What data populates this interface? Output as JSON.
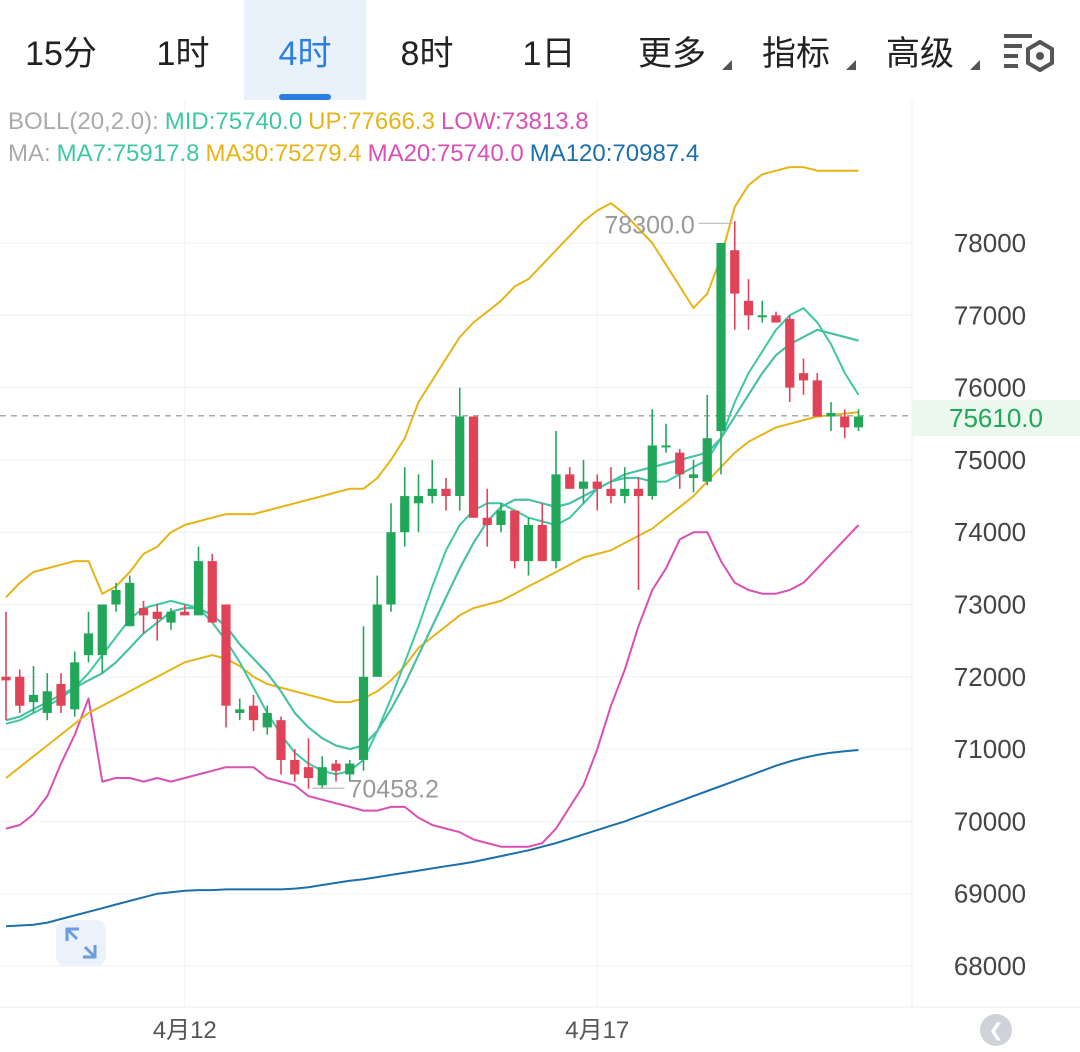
{
  "tabs": [
    {
      "label": "15分",
      "active": false,
      "dropdown": false
    },
    {
      "label": "1时",
      "active": false,
      "dropdown": false
    },
    {
      "label": "4时",
      "active": true,
      "dropdown": false
    },
    {
      "label": "8时",
      "active": false,
      "dropdown": false
    },
    {
      "label": "1日",
      "active": false,
      "dropdown": false
    },
    {
      "label": "更多",
      "active": false,
      "dropdown": true
    },
    {
      "label": "指标",
      "active": false,
      "dropdown": true
    },
    {
      "label": "高级",
      "active": false,
      "dropdown": true
    }
  ],
  "settings_icon": "chart-settings-icon",
  "legend": {
    "boll_name": "BOLL(20,2.0):",
    "boll_mid": "MID:75740.0",
    "boll_up": "UP:77666.3",
    "boll_low": "LOW:73813.8",
    "ma_name": "MA:",
    "ma7": "MA7:75917.8",
    "ma30": "MA30:75279.4",
    "ma20": "MA20:75740.0",
    "ma120": "MA120:70987.4"
  },
  "colors": {
    "up": "#22a65a",
    "down": "#e04358",
    "boll_mid": "#3ec7a3",
    "boll_up": "#e6b417",
    "boll_low": "#d94fb5",
    "ma7": "#3ec7a3",
    "ma30": "#e6b417",
    "ma20": "#d94fb5",
    "ma120": "#1b6fab",
    "price_line": "#aaaaaa"
  },
  "current_price": "75610.0",
  "high_label": "78300.0",
  "low_label": "70458.2",
  "chart_data": {
    "type": "candlestick",
    "y_ticks": [
      "78000",
      "77000",
      "76000",
      "75000",
      "74000",
      "73000",
      "72000",
      "71000",
      "70000",
      "69000",
      "68000"
    ],
    "ylim": [
      67600,
      79600
    ],
    "x_labels": [
      {
        "label": "4月12",
        "index": 13
      },
      {
        "label": "4月17",
        "index": 43
      }
    ],
    "current_price": 75610,
    "candles": [
      [
        72000,
        71950,
        72900,
        71400
      ],
      [
        72000,
        71600,
        72100,
        71500
      ],
      [
        71650,
        71750,
        72150,
        71500
      ],
      [
        71500,
        71800,
        72050,
        71400
      ],
      [
        71900,
        71600,
        72050,
        71500
      ],
      [
        71550,
        72200,
        72350,
        71450
      ],
      [
        72300,
        72600,
        72900,
        72200
      ],
      [
        72300,
        73000,
        73000,
        72050
      ],
      [
        73000,
        73200,
        73300,
        72900
      ],
      [
        72700,
        73300,
        73400,
        72700
      ],
      [
        72950,
        72850,
        73050,
        72600
      ],
      [
        72900,
        72800,
        73000,
        72500
      ],
      [
        72750,
        72900,
        72950,
        72650
      ],
      [
        72900,
        72850,
        73000,
        72850
      ],
      [
        72850,
        73600,
        73800,
        72900
      ],
      [
        73600,
        72750,
        73700,
        72750
      ],
      [
        73000,
        71600,
        73000,
        71300
      ],
      [
        71500,
        71550,
        71700,
        71400
      ],
      [
        71600,
        71400,
        71750,
        71250
      ],
      [
        71300,
        71500,
        71600,
        71200
      ],
      [
        71400,
        70850,
        71450,
        70650
      ],
      [
        70850,
        70650,
        71000,
        70550
      ],
      [
        70750,
        70600,
        71150,
        70450
      ],
      [
        70500,
        70750,
        70900,
        70450
      ],
      [
        70800,
        70700,
        70850,
        70550
      ],
      [
        70650,
        70800,
        70850,
        70550
      ],
      [
        70850,
        72000,
        72700,
        70700
      ],
      [
        72000,
        73000,
        73400,
        72000
      ],
      [
        73000,
        74000,
        74400,
        72900
      ],
      [
        74000,
        74500,
        74900,
        73800
      ],
      [
        74400,
        74500,
        74800,
        74000
      ],
      [
        74500,
        74600,
        75000,
        74400
      ],
      [
        74600,
        74500,
        74750,
        74300
      ],
      [
        74500,
        75600,
        76000,
        74300
      ],
      [
        75600,
        74200,
        75600,
        74200
      ],
      [
        74200,
        74100,
        74600,
        73800
      ],
      [
        74100,
        74300,
        74400,
        74000
      ],
      [
        74300,
        73600,
        74300,
        73500
      ],
      [
        73600,
        74100,
        74200,
        73400
      ],
      [
        74100,
        73600,
        74400,
        73600
      ],
      [
        73600,
        74800,
        75400,
        73500
      ],
      [
        74800,
        74600,
        74900,
        74600
      ],
      [
        74600,
        74700,
        75000,
        74400
      ],
      [
        74700,
        74600,
        74800,
        74300
      ],
      [
        74600,
        74500,
        74900,
        74400
      ],
      [
        74500,
        74600,
        74900,
        74400
      ],
      [
        74600,
        74500,
        74750,
        73200
      ],
      [
        74500,
        75200,
        75700,
        74450
      ],
      [
        75200,
        75200,
        75500,
        75100
      ],
      [
        75100,
        74800,
        75150,
        74600
      ],
      [
        74750,
        74800,
        75000,
        74550
      ],
      [
        74700,
        75300,
        75900,
        74650
      ],
      [
        75400,
        78000,
        78000,
        74800
      ],
      [
        77900,
        77300,
        78300,
        76800
      ],
      [
        77200,
        77000,
        77500,
        76800
      ],
      [
        77000,
        77000,
        77200,
        76900
      ],
      [
        77000,
        76900,
        77050,
        76900
      ],
      [
        76950,
        76000,
        77000,
        75800
      ],
      [
        76200,
        76100,
        76400,
        75900
      ],
      [
        76100,
        75600,
        76200,
        75600
      ],
      [
        75600,
        75650,
        75800,
        75400
      ],
      [
        75600,
        75450,
        75700,
        75300
      ],
      [
        75450,
        75600,
        75700,
        75400
      ]
    ],
    "series": [
      {
        "name": "MID",
        "values": [
          71400,
          71450,
          71550,
          71650,
          71750,
          71850,
          71950,
          72050,
          72200,
          72400,
          72600,
          72750,
          72900,
          72950,
          72950,
          72850,
          72700,
          72450,
          72250,
          72050,
          71800,
          71500,
          71300,
          71150,
          71050,
          71000,
          71050,
          71250,
          71550,
          71900,
          72300,
          72700,
          73100,
          73500,
          73850,
          74150,
          74350,
          74450,
          74450,
          74400,
          74350,
          74400,
          74500,
          74600,
          74700,
          74800,
          74850,
          74900,
          74950,
          75000,
          75050,
          75100,
          75300,
          75600,
          75900,
          76200,
          76450,
          76600,
          76700,
          76800,
          76750,
          76700,
          76650
        ]
      },
      {
        "name": "UP",
        "values": [
          73100,
          73300,
          73450,
          73500,
          73550,
          73600,
          73600,
          73150,
          73250,
          73450,
          73700,
          73800,
          74000,
          74100,
          74150,
          74200,
          74250,
          74250,
          74250,
          74300,
          74350,
          74400,
          74450,
          74500,
          74550,
          74600,
          74600,
          74750,
          75000,
          75300,
          75800,
          76100,
          76400,
          76700,
          76900,
          77050,
          77200,
          77400,
          77500,
          77700,
          77900,
          78100,
          78300,
          78450,
          78550,
          78400,
          78200,
          78000,
          77700,
          77400,
          77100,
          77300,
          77800,
          78500,
          78800,
          78950,
          79000,
          79050,
          79050,
          79000,
          79000,
          79000,
          79000
        ]
      },
      {
        "name": "LOW",
        "values": [
          69900,
          69950,
          70100,
          70350,
          70800,
          71200,
          71700,
          70550,
          70600,
          70600,
          70550,
          70600,
          70550,
          70600,
          70650,
          70700,
          70750,
          70750,
          70750,
          70600,
          70550,
          70500,
          70350,
          70300,
          70250,
          70200,
          70150,
          70150,
          70200,
          70200,
          70050,
          69950,
          69900,
          69850,
          69750,
          69700,
          69650,
          69650,
          69650,
          69700,
          69900,
          70200,
          70500,
          71000,
          71600,
          72100,
          72700,
          73200,
          73500,
          73900,
          74000,
          74000,
          73600,
          73300,
          73200,
          73150,
          73150,
          73200,
          73300,
          73500,
          73700,
          73900,
          74100
        ]
      },
      {
        "name": "MA7",
        "values": [
          71350,
          71400,
          71500,
          71600,
          71700,
          71850,
          72050,
          72300,
          72550,
          72800,
          72950,
          73000,
          73050,
          73000,
          72950,
          72750,
          72500,
          72200,
          71850,
          71500,
          71200,
          70950,
          70800,
          70700,
          70650,
          70700,
          70850,
          71250,
          71700,
          72200,
          72700,
          73250,
          73750,
          74100,
          74300,
          74400,
          74400,
          74300,
          74200,
          74150,
          74100,
          74200,
          74400,
          74600,
          74700,
          74750,
          74750,
          74700,
          74700,
          74800,
          74900,
          75000,
          75300,
          75800,
          76200,
          76500,
          76800,
          77000,
          77100,
          76900,
          76600,
          76200,
          75900
        ]
      },
      {
        "name": "MA30",
        "values": [
          70600,
          70750,
          70900,
          71050,
          71200,
          71350,
          71500,
          71600,
          71700,
          71800,
          71900,
          72000,
          72100,
          72200,
          72250,
          72300,
          72250,
          72150,
          72000,
          71900,
          71850,
          71800,
          71750,
          71700,
          71650,
          71650,
          71700,
          71800,
          71950,
          72150,
          72400,
          72550,
          72700,
          72850,
          72950,
          73000,
          73050,
          73150,
          73250,
          73350,
          73450,
          73550,
          73650,
          73700,
          73750,
          73850,
          73950,
          74050,
          74200,
          74350,
          74500,
          74700,
          74900,
          75100,
          75250,
          75350,
          75450,
          75500,
          75550,
          75600,
          75620,
          75640,
          75660
        ]
      },
      {
        "name": "MA20",
        "values": [
          71400,
          71450,
          71550,
          71650,
          71750,
          71850,
          71950,
          72050,
          72200,
          72400,
          72600,
          72750,
          72900,
          72950,
          72950,
          72850,
          72700,
          72450,
          72250,
          72050,
          71800,
          71500,
          71300,
          71150,
          71050,
          71000,
          71050,
          71250,
          71550,
          71900,
          72300,
          72700,
          73100,
          73500,
          73850,
          74150,
          74350,
          74450,
          74450,
          74400,
          74350,
          74400,
          74500,
          74600,
          74700,
          74800,
          74850,
          74900,
          74950,
          75000,
          75050,
          75100,
          75300,
          75600,
          75900,
          76200,
          76450,
          76600,
          76700,
          76800,
          76750,
          76700,
          76650
        ]
      },
      {
        "name": "MA120",
        "values": [
          68550,
          68560,
          68570,
          68600,
          68650,
          68700,
          68750,
          68800,
          68850,
          68900,
          68950,
          69000,
          69020,
          69040,
          69050,
          69050,
          69060,
          69060,
          69060,
          69060,
          69060,
          69070,
          69090,
          69120,
          69150,
          69180,
          69200,
          69230,
          69260,
          69290,
          69320,
          69350,
          69380,
          69410,
          69440,
          69480,
          69520,
          69560,
          69600,
          69650,
          69700,
          69760,
          69820,
          69880,
          69940,
          70000,
          70070,
          70140,
          70210,
          70280,
          70350,
          70420,
          70490,
          70560,
          70630,
          70700,
          70770,
          70830,
          70880,
          70920,
          70950,
          70970,
          70987
        ]
      }
    ]
  }
}
